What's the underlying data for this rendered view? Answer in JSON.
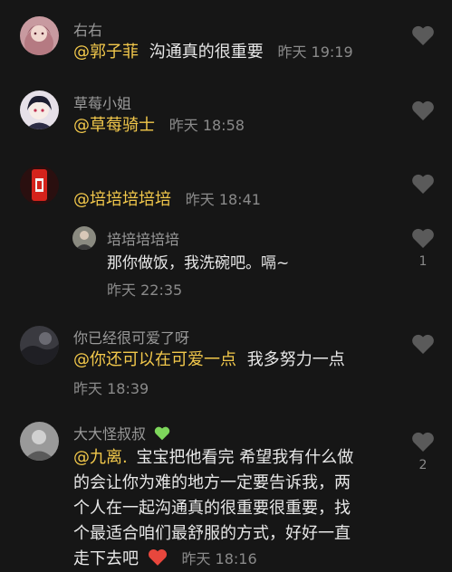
{
  "colors": {
    "background": "#161616",
    "mention": "#f2c84b",
    "username": "#9a9a9a",
    "body_text": "#e8e8e8",
    "time": "#8a8a8a",
    "heart_outline": "#5a5a5a",
    "red_heart": "#e8473d",
    "green_heart": "#7dd65b"
  },
  "comments": [
    {
      "username": "右右",
      "mention": "@郭子菲",
      "text": "沟通真的很重要",
      "time": "昨天 19:19",
      "avatar_icon": "anime-girl-avatar-icon",
      "like_icon": "heart-outline-icon"
    },
    {
      "username": "草莓小姐",
      "mention": "@草莓骑士",
      "text": "",
      "time": "昨天 18:58",
      "avatar_icon": "anime-character-avatar-icon",
      "like_icon": "heart-outline-icon"
    },
    {
      "username": "",
      "mention": "@培培培培培",
      "text": "",
      "time": "昨天 18:41",
      "avatar_icon": "red-supreme-avatar-icon",
      "like_icon": "heart-outline-icon"
    },
    {
      "username": "培培培培培",
      "mention": "",
      "text": "那你做饭，我洗碗吧。嗝~",
      "time": "昨天 22:35",
      "like_count": "1",
      "avatar_icon": "person-avatar-icon",
      "like_icon": "heart-outline-icon"
    },
    {
      "username": "你已经很可爱了呀",
      "mention": "@你还可以在可爱一点",
      "text": "我多努力一点",
      "time": "昨天 18:39",
      "avatar_icon": "dark-photo-avatar-icon",
      "like_icon": "heart-outline-icon"
    },
    {
      "username": "大大怪叔叔",
      "username_emoji": "green-heart-icon",
      "mention": "@九离.",
      "text_line1": "宝宝把他看完 希望我有什么做",
      "text_line2": "的会让你为难的地方一定要告诉我，两",
      "text_line3": "个人在一起沟通真的很重要很重要，找",
      "text_line4": "个最适合咱们最舒服的方式，好好一直",
      "text_line5": "走下去吧",
      "end_emoji": "red-heart-icon",
      "time": "昨天 18:16",
      "like_count": "2",
      "avatar_icon": "grey-photo-avatar-icon",
      "like_icon": "heart-outline-icon"
    }
  ]
}
